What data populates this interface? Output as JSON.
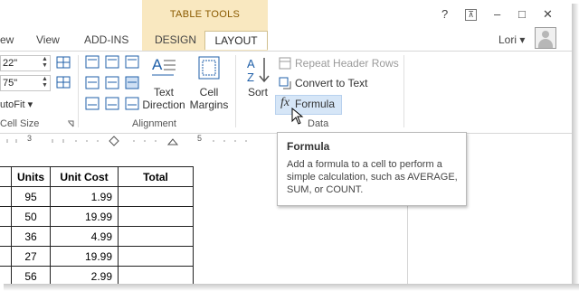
{
  "contextual_label": "TABLE TOOLS",
  "tabs": [
    "ew",
    "View",
    "ADD-INS",
    "DESIGN",
    "LAYOUT"
  ],
  "active_tab": "LAYOUT",
  "window_controls": {
    "help": "?",
    "restore_ribbon": "⊼",
    "minimize": "–",
    "maximize": "□",
    "close": "✕"
  },
  "user": {
    "name": "Lori"
  },
  "cell_size": {
    "height_value": "22\"",
    "width_value": "75\"",
    "autofit": "utoFit",
    "label": "Cell Size"
  },
  "alignment": {
    "text_direction_line1": "Text",
    "text_direction_line2": "Direction",
    "cell_margins_line1": "Cell",
    "cell_margins_line2": "Margins",
    "label": "Alignment"
  },
  "data_group": {
    "sort": "Sort",
    "repeat_header_rows": "Repeat Header Rows",
    "convert_to_text": "Convert to Text",
    "formula": "Formula",
    "label": "Data"
  },
  "ruler": {
    "mark3": "3",
    "mark5": "5"
  },
  "tooltip": {
    "title": "Formula",
    "body": "Add a formula to a cell to perform a simple calculation, such as AVERAGE, SUM, or COUNT."
  },
  "table": {
    "headers": [
      "Units",
      "Unit Cost",
      "Total"
    ],
    "rows": [
      [
        "95",
        "1.99",
        ""
      ],
      [
        "50",
        "19.99",
        ""
      ],
      [
        "36",
        "4.99",
        ""
      ],
      [
        "27",
        "19.99",
        ""
      ],
      [
        "56",
        "2.99",
        ""
      ]
    ]
  },
  "colors": {
    "contextual_tab": "#f9e8c0",
    "hover": "#d6e6f7"
  }
}
